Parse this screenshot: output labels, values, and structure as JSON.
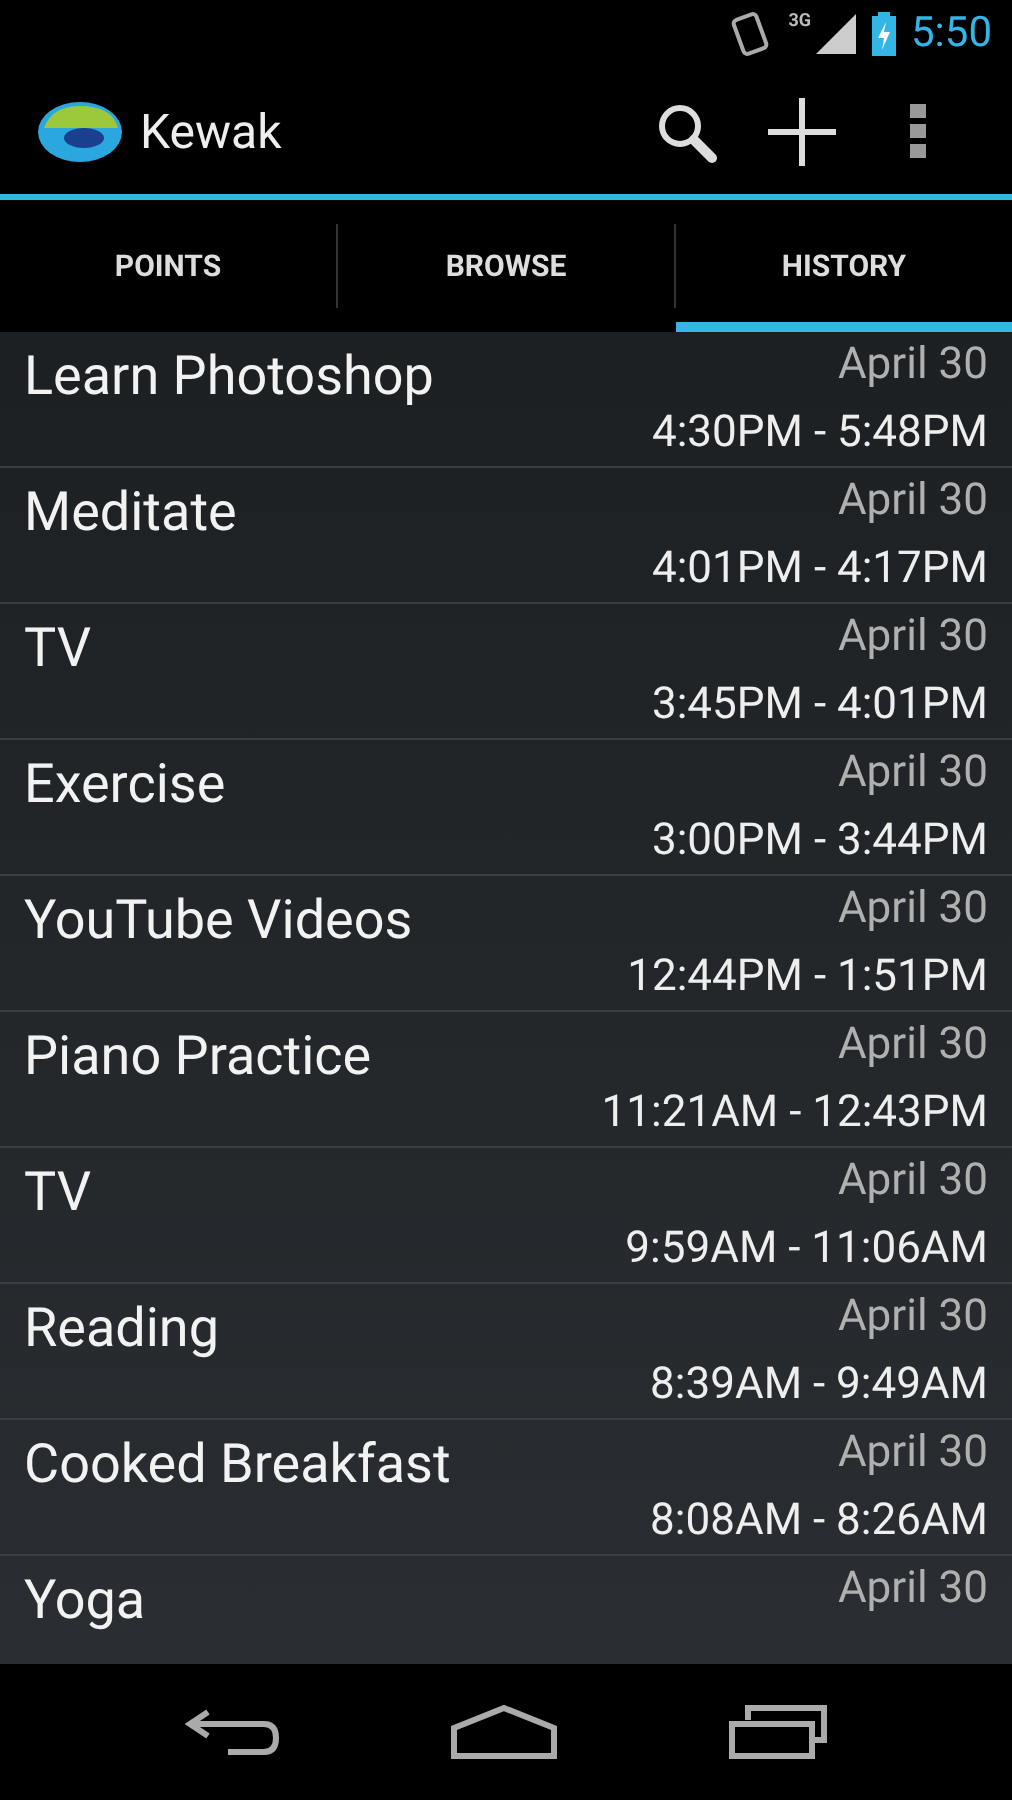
{
  "status_bar": {
    "time": "5:50",
    "network": "3G"
  },
  "action_bar": {
    "title": "Kewak"
  },
  "tabs": [
    {
      "label": "POINTS",
      "selected": false
    },
    {
      "label": "BROWSE",
      "selected": false
    },
    {
      "label": "HISTORY",
      "selected": true
    }
  ],
  "history": [
    {
      "name": "Learn Photoshop",
      "date": "April 30",
      "time": "4:30PM - 5:48PM"
    },
    {
      "name": "Meditate",
      "date": "April 30",
      "time": "4:01PM - 4:17PM"
    },
    {
      "name": "TV",
      "date": "April 30",
      "time": "3:45PM - 4:01PM"
    },
    {
      "name": "Exercise",
      "date": "April 30",
      "time": "3:00PM - 3:44PM"
    },
    {
      "name": "YouTube Videos",
      "date": "April 30",
      "time": "12:44PM - 1:51PM"
    },
    {
      "name": "Piano Practice",
      "date": "April 30",
      "time": "11:21AM - 12:43PM"
    },
    {
      "name": "TV",
      "date": "April 30",
      "time": "9:59AM - 11:06AM"
    },
    {
      "name": "Reading",
      "date": "April 30",
      "time": "8:39AM - 9:49AM"
    },
    {
      "name": "Cooked Breakfast",
      "date": "April 30",
      "time": "8:08AM - 8:26AM"
    },
    {
      "name": "Yoga",
      "date": "April 30"
    }
  ]
}
